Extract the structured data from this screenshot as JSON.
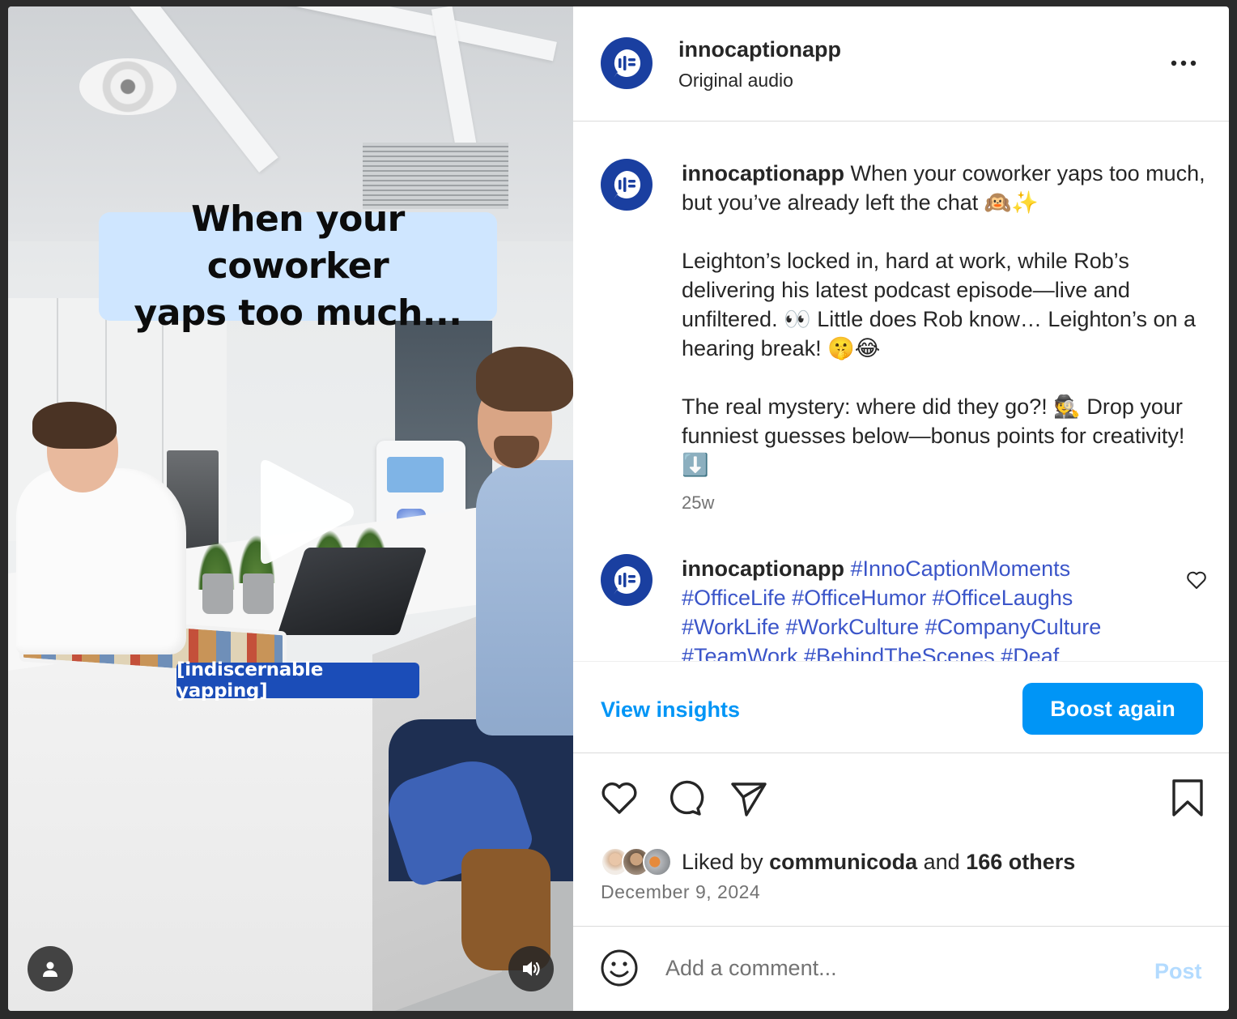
{
  "video": {
    "caption_line1": "When your coworker",
    "caption_line2": "yaps too much...",
    "sub_caption": "[indiscernable yapping]"
  },
  "header": {
    "username": "innocaptionapp",
    "audio": "Original audio"
  },
  "post": {
    "username": "innocaptionapp",
    "caption_p1": "When your coworker yaps too much, but you’ve already left the chat 🙉✨",
    "caption_p2": "Leighton’s locked in, hard at work, while Rob’s delivering his latest podcast episode—live and unfiltered. 👀 Little does Rob know… Leighton’s on a hearing break! 🤫😂",
    "caption_p3": "The real mystery: where did they go?! 🕵️ Drop your funniest guesses below—bonus points for creativity! ⬇️",
    "time": "25w"
  },
  "comment": {
    "username": "innocaptionapp",
    "hashtags": "#InnoCaptionMoments #OfficeLife #OfficeHumor #OfficeLaughs #WorkLife #WorkCulture #CompanyCulture #TeamWork #BehindTheScenes #Deaf"
  },
  "insights": {
    "view_label": "View insights",
    "boost_label": "Boost again"
  },
  "likes": {
    "prefix": "Liked by",
    "user": "communicoda",
    "and": "and",
    "others": "166 others"
  },
  "date": "December 9, 2024",
  "comment_box": {
    "placeholder": "Add a comment...",
    "post_label": "Post"
  },
  "colors": {
    "accent": "#0095f6",
    "hashtag": "#3b55c9",
    "avatar": "#1a3fa0"
  }
}
